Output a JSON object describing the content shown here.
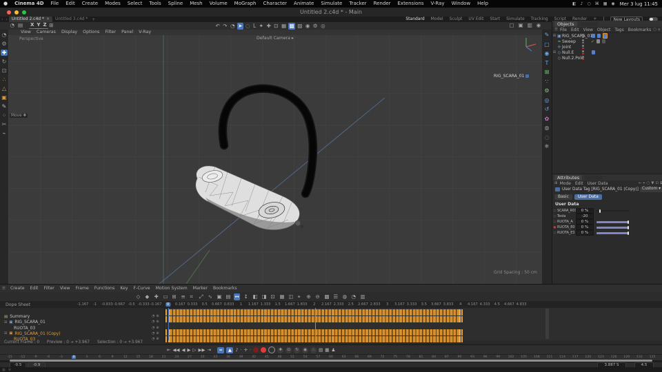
{
  "menubar": {
    "app": "Cinema 4D",
    "items": [
      "File",
      "Edit",
      "Create",
      "Modes",
      "Select",
      "Tools",
      "Spline",
      "Mesh",
      "Volume",
      "MoGraph",
      "Character",
      "Animate",
      "Simulate",
      "Tracker",
      "Render",
      "Extensions",
      "V-Ray",
      "Window",
      "Help"
    ],
    "status_icons": [
      {
        "name": "display-icon",
        "glyph": "◧"
      },
      {
        "name": "volume-icon",
        "glyph": "♪"
      },
      {
        "name": "search-icon",
        "glyph": "○"
      },
      {
        "name": "keyboard-icon",
        "glyph": "⌘"
      },
      {
        "name": "spotlight-icon",
        "glyph": "▦"
      },
      {
        "name": "control-center-icon",
        "glyph": "◉"
      }
    ],
    "clock": "Mer 3 lug 11:45"
  },
  "titlebar": {
    "title": "Untitled 2.c4d * - Main"
  },
  "doc_tabs": {
    "tabs": [
      {
        "label": "Untitled 2.c4d *",
        "active": true
      },
      {
        "label": "Untitled 3.c4d *",
        "active": false
      }
    ],
    "add_label": "+",
    "close_glyph": "×"
  },
  "layouts": {
    "items": [
      "Standard",
      "Model",
      "Sculpt",
      "UV Edit",
      "Start",
      "Simulate",
      "Tracking",
      "Script",
      "Render"
    ],
    "active": "Standard",
    "add_label": "+",
    "new_layouts_label": "New Layouts"
  },
  "toolbar": {
    "left_icons": [
      {
        "name": "history-icon",
        "glyph": "◔"
      },
      {
        "name": "project-folder-icon",
        "glyph": "▤"
      }
    ],
    "axis_locks": [
      {
        "name": "axis-x-lock",
        "label": "X",
        "color": "#d05050"
      },
      {
        "name": "axis-y-lock",
        "label": "Y",
        "color": "#56a556"
      },
      {
        "name": "axis-z-lock",
        "label": "Z",
        "color": "#5577cc"
      }
    ],
    "workplane_icon": {
      "name": "workplane-icon",
      "glyph": "⊞"
    },
    "center_icons": [
      {
        "name": "undo-icon",
        "glyph": "↶"
      },
      {
        "name": "redo-icon",
        "glyph": "↷"
      },
      {
        "name": "history-state-icon",
        "glyph": "◔"
      },
      {
        "name": "live-selection-icon",
        "glyph": "➤",
        "active": true
      },
      {
        "name": "lasso-selection-icon",
        "glyph": "◌"
      },
      {
        "name": "coordinate-icon",
        "glyph": "L"
      },
      {
        "name": "snap-icon",
        "glyph": "✦"
      },
      {
        "name": "move-icon",
        "glyph": "✚"
      },
      {
        "name": "scale-icon",
        "glyph": "⊡"
      },
      {
        "name": "quantize-grid-icon",
        "glyph": "▦"
      },
      {
        "name": "workplane-mode-icon",
        "glyph": "▩",
        "active": true
      },
      {
        "name": "locked-workplane-icon",
        "glyph": "▨"
      },
      {
        "name": "render-view-icon",
        "glyph": "◉"
      },
      {
        "name": "render-settings-icon",
        "glyph": "⚙"
      },
      {
        "name": "interactive-render-icon",
        "glyph": "◎"
      }
    ],
    "right_icons": [
      {
        "name": "layout-single-view-icon",
        "glyph": "▢"
      },
      {
        "name": "layout-quad-view-icon",
        "glyph": "▣"
      },
      {
        "name": "layout-split-view-icon",
        "glyph": "▥"
      },
      {
        "name": "render-globe-icon",
        "glyph": "◉"
      }
    ]
  },
  "left_toolbar": [
    {
      "name": "undo-history-icon",
      "glyph": "◔",
      "color": "#9a9a9a"
    },
    {
      "name": "settings-gear-icon",
      "glyph": "⚙",
      "color": "#9a9a9a"
    },
    {
      "name": "move-tool-icon",
      "glyph": "✚",
      "active": true
    },
    {
      "name": "rotate-tool-icon",
      "glyph": "↻",
      "color": "#9a9a9a"
    },
    {
      "name": "scale-tool-icon",
      "glyph": "⊡",
      "color": "#9a9a9a"
    },
    {
      "name": "points-mode-icon",
      "glyph": "∴",
      "color": "#d89a3a"
    },
    {
      "name": "edges-mode-icon",
      "glyph": "△",
      "color": "#d89a3a"
    },
    {
      "name": "polygons-mode-icon",
      "glyph": "▣",
      "color": "#d89a3a"
    },
    {
      "name": "spline-pen-icon",
      "glyph": "✎",
      "color": "#bdbdbd"
    },
    {
      "name": "axis-mode-icon",
      "glyph": "⁘",
      "color": "#d89a3a"
    },
    {
      "name": "knife-tool-icon",
      "glyph": "✂",
      "color": "#9a9a9a"
    },
    {
      "name": "magnet-tool-icon",
      "glyph": "⌁",
      "color": "#d89a3a"
    }
  ],
  "right_toolbar": [
    {
      "name": "spline-pen-icon",
      "glyph": "✎",
      "color": "#6fa8dc"
    },
    {
      "name": "cube-primitive-icon",
      "glyph": "▢",
      "color": "#6fa8dc"
    },
    {
      "name": "sphere-primitive-icon",
      "glyph": "◉",
      "color": "#6fa8dc"
    },
    {
      "name": "text-object-icon",
      "glyph": "T",
      "color": "#6fa8dc"
    },
    {
      "name": "subdivision-surface-icon",
      "glyph": "⊞",
      "color": "#7ec87e"
    },
    {
      "name": "array-generator-icon",
      "glyph": "∵",
      "color": "#7ec87e"
    },
    {
      "name": "generator-gear-icon",
      "glyph": "⚙",
      "color": "#7ec87e"
    },
    {
      "name": "torus-spline-icon",
      "glyph": "◎",
      "color": "#6fa8dc"
    },
    {
      "name": "arc-spline-icon",
      "glyph": "↺",
      "color": "#6fa8dc"
    },
    {
      "name": "mograph-cloner-icon",
      "glyph": "✿",
      "color": "#c27bc2"
    },
    {
      "name": "deformer-icon",
      "glyph": "◍",
      "color": "#9a9a9a"
    },
    {
      "name": "field-icon",
      "glyph": "◌",
      "color": "#9a9a9a"
    },
    {
      "name": "particles-icon",
      "glyph": "❄",
      "color": "#9a9a9a"
    }
  ],
  "viewport": {
    "menu": [
      "View",
      "Cameras",
      "Display",
      "Options",
      "Filter",
      "Panel",
      "V-Ray"
    ],
    "projection": "Perspective",
    "camera_label": "Default Camera ▸",
    "hud_object": "RIG_SCARA_01",
    "grid_spacing": "Grid Spacing : 50 cm",
    "tooltip": "Move ✚"
  },
  "objects_panel": {
    "tab": "Objects",
    "menu": [
      "File",
      "Edit",
      "View",
      "Object",
      "Tags",
      "Bookmarks"
    ],
    "menu_icons": [
      {
        "name": "search-icon",
        "glyph": "○"
      },
      {
        "name": "home-icon",
        "glyph": "⌂"
      },
      {
        "name": "filter-icon",
        "glyph": "▼"
      }
    ],
    "rows": [
      {
        "name": "RIG_SCARA_01",
        "icon_glyph": "▣",
        "icon_color": "#7aa2d8",
        "expander": true,
        "dots": "gray",
        "tags": [
          "blue",
          "blue",
          "blue-selected"
        ],
        "check": false
      },
      {
        "name": "Sweep",
        "icon_glyph": "≈",
        "icon_color": "#7ec87e",
        "expander": false,
        "dots": "gray",
        "tags": [
          "gray",
          "darkgray"
        ],
        "check": true
      },
      {
        "name": "Joint",
        "icon_glyph": "✛",
        "icon_color": "#7aa2d8",
        "expander": false,
        "dots": "red",
        "tags": [],
        "check": false
      },
      {
        "name": "Null.E",
        "icon_glyph": "◇",
        "icon_color": "#7aa2d8",
        "expander": true,
        "dots": "red",
        "tags": [
          "blue"
        ],
        "check": false
      },
      {
        "name": "Null.2.Pole",
        "icon_glyph": "◇",
        "icon_color": "#7aa2d8",
        "expander": false,
        "dots": "red",
        "tags": [],
        "check": false
      }
    ]
  },
  "attributes_panel": {
    "tab": "Attributes",
    "menu": [
      "Mode",
      "Edit",
      "User Data"
    ],
    "menu_icons": [
      {
        "name": "back-icon",
        "glyph": "←"
      },
      {
        "name": "target-icon",
        "glyph": "⌖"
      },
      {
        "name": "search-icon",
        "glyph": "○"
      },
      {
        "name": "filter-icon",
        "glyph": "▼"
      },
      {
        "name": "lock-icon",
        "glyph": "⊡"
      },
      {
        "name": "copy-icon",
        "glyph": "⧉"
      }
    ],
    "title": "User Data Tag [RIG_SCARA_01 (Copy)]",
    "preset": "Custom ▾",
    "subtabs": [
      "Basic",
      "User Data"
    ],
    "active_subtab": "User Data",
    "section": "User Data",
    "params": [
      {
        "name": "SCARA_R01",
        "value": "0 %",
        "slider": "left",
        "keyed": false
      },
      {
        "name": "Testa",
        "value": "-20",
        "slider": "none",
        "keyed": false
      },
      {
        "name": "RUOTA_A",
        "value": "0 %",
        "slider": "right",
        "keyed": false
      },
      {
        "name": "RUOTA_E0",
        "value": "0 %",
        "slider": "right",
        "keyed": true
      },
      {
        "name": "RUOTA_E3",
        "value": "0 %",
        "slider": "right",
        "keyed": false
      }
    ]
  },
  "timeline": {
    "label": "Dope Sheet",
    "menu": [
      "Create",
      "Edit",
      "Filter",
      "View",
      "Frame",
      "Functions",
      "Key",
      "F-Curve",
      "Motion System",
      "Marker",
      "Bookmarks"
    ],
    "icon_glyphs": [
      "◇",
      "◆",
      "✚",
      "▭",
      "⊞",
      "≡",
      "⌗",
      "⤢",
      "∿",
      "▣",
      "▤",
      "↔",
      "↕",
      "◧",
      "◨",
      "⊡",
      "▦",
      "◫",
      "⌖",
      "⊕",
      "⊖",
      "▩",
      "☰",
      "◍",
      "◔",
      "▥"
    ],
    "active_icon_index": 11,
    "ruler_labels": [
      "-1.167",
      "-1",
      "-0.833",
      "-0.667",
      "-0.5",
      "-0.333",
      "-0.167",
      "0",
      "0.167",
      "0.333",
      "0.5",
      "0.667",
      "0.833",
      "1",
      "1.167",
      "1.333",
      "1.5",
      "1.667",
      "1.833",
      "2",
      "2.167",
      "2.333",
      "2.5",
      "2.667",
      "2.833",
      "3",
      "3.167",
      "3.333",
      "3.5",
      "3.667",
      "3.833",
      "4",
      "4.167",
      "4.333",
      "4.5",
      "4.667",
      "4.833"
    ],
    "current_label_index": 7,
    "tree": [
      {
        "name": "Summary",
        "icon_glyph": "▤",
        "icon_color": "#c0b090",
        "indent": 0,
        "highlight": false,
        "expander": false
      },
      {
        "name": "RIG_SCARA_01",
        "icon_glyph": "▣",
        "icon_color": "#7aa2d8",
        "indent": 0,
        "highlight": false,
        "expander": true
      },
      {
        "name": "RUOTA_03",
        "icon_glyph": "",
        "icon_color": "",
        "indent": 1,
        "highlight": false,
        "expander": false
      },
      {
        "name": "RIG_SCARA_01 (Copy)",
        "icon_glyph": "▣",
        "icon_color": "#d8973a",
        "indent": 0,
        "highlight": true,
        "expander": true
      },
      {
        "name": "RUOTA_03",
        "icon_glyph": "",
        "icon_color": "",
        "indent": 1,
        "highlight": true,
        "expander": false
      }
    ],
    "row_icons": [
      "◔",
      "⊕"
    ],
    "keyframe_bar_rows": [
      1.5,
      12,
      30.5,
      41
    ],
    "status": "Current Frame : 0      Preview : 0 → +3.967      Selection : 0 → +3.967"
  },
  "transport": {
    "buttons": [
      {
        "name": "go-start-button",
        "glyph": "⇤"
      },
      {
        "name": "prev-key-button",
        "glyph": "◀◀"
      },
      {
        "name": "prev-frame-button",
        "glyph": "◀"
      },
      {
        "name": "play-button",
        "glyph": "▶"
      },
      {
        "name": "play-forward-button",
        "glyph": "▷"
      },
      {
        "name": "next-key-button",
        "glyph": "▶▶"
      },
      {
        "name": "go-end-button",
        "glyph": "⇥"
      }
    ],
    "toggles": [
      {
        "name": "playback-loop-toggle",
        "glyph": "≈"
      },
      {
        "name": "keyframe-snap-toggle",
        "glyph": "▲"
      }
    ],
    "sound_icon": {
      "name": "sound-icon",
      "glyph": "♪"
    },
    "key_nav_icon": {
      "name": "autokey-target-icon",
      "glyph": "✛"
    },
    "record_circles": [
      {
        "name": "record-transform-icon",
        "color": "#7a1d1d"
      },
      {
        "name": "record-button",
        "color": "#e23b3b"
      },
      {
        "name": "keyframe-selection-icon",
        "color": "#303030"
      }
    ],
    "autokey_buttons": [
      {
        "name": "record-position-toggle",
        "glyph": "✚"
      },
      {
        "name": "record-scale-toggle",
        "glyph": "⊡"
      },
      {
        "name": "record-rotation-toggle",
        "glyph": "↻"
      },
      {
        "name": "record-parameter-toggle",
        "glyph": "◉"
      },
      {
        "name": "record-point-level-toggle",
        "glyph": "∴"
      }
    ],
    "extra_icons": [
      {
        "name": "keyframe-presets-icon",
        "glyph": "▤"
      },
      {
        "name": "motion-clip-icon",
        "glyph": "▦"
      },
      {
        "name": "character-icon",
        "glyph": "♟"
      }
    ]
  },
  "powerslider": {
    "frame_labels": [
      "-15",
      "-12",
      "-9",
      "-6",
      "-3",
      "0",
      "3",
      "6",
      "9",
      "12",
      "15",
      "18",
      "21",
      "24",
      "27",
      "30",
      "33",
      "36",
      "39",
      "42",
      "45",
      "48",
      "51",
      "54",
      "57",
      "60",
      "63",
      "66",
      "69",
      "72",
      "75",
      "78",
      "81",
      "84",
      "87",
      "90",
      "93",
      "96",
      "99",
      "102",
      "105",
      "108",
      "111",
      "114",
      "117",
      "120",
      "123",
      "126",
      "129",
      "132",
      "135"
    ],
    "current_frame_index": 5,
    "range_start": "-0.5",
    "range_start2": "-0.9",
    "selection_info": "3.887 S",
    "range_end": "4.5"
  },
  "bottom_icons": [
    {
      "name": "grid-view-icon",
      "glyph": "▦"
    },
    {
      "name": "add-panel-icon",
      "glyph": "⊕"
    }
  ],
  "colors": {
    "accent_blue": "#4a76b8",
    "keyframe_orange": "#d79030",
    "highlight_orange": "#e0a23f",
    "slider_blue": "#7d88cc",
    "record_red": "#e23b3b",
    "tag_blue": "#5a7ec8"
  }
}
